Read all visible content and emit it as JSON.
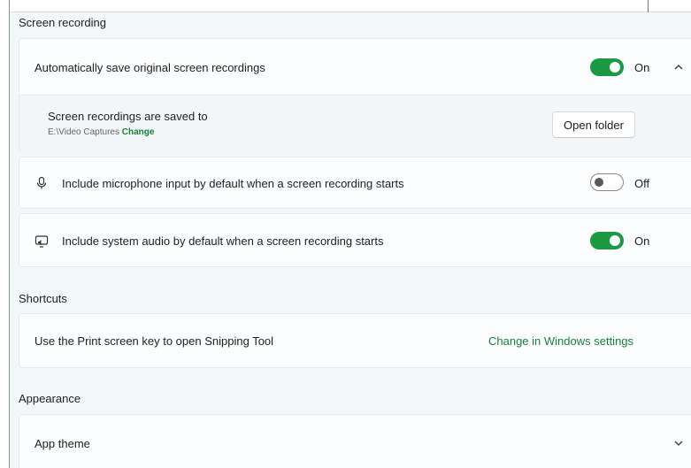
{
  "screen_recording": {
    "section_title": "Screen recording",
    "auto_save": {
      "label": "Automatically save original screen recordings",
      "state": "On",
      "enabled": true
    },
    "save_location": {
      "label": "Screen recordings are saved to",
      "path": "E:\\Video Captures",
      "change_link": "Change",
      "open_folder_button": "Open folder"
    },
    "microphone": {
      "label": "Include microphone input by default when a screen recording starts",
      "state": "Off",
      "enabled": false,
      "icon": "microphone-icon"
    },
    "system_audio": {
      "label": "Include system audio by default when a screen recording starts",
      "state": "On",
      "enabled": true,
      "icon": "system-audio-icon"
    }
  },
  "shortcuts": {
    "section_title": "Shortcuts",
    "print_screen": {
      "label": "Use the Print screen key to open Snipping Tool",
      "link": "Change in Windows settings"
    }
  },
  "appearance": {
    "section_title": "Appearance",
    "app_theme": {
      "label": "App theme"
    }
  },
  "colors": {
    "accent": "#1a9a43",
    "link": "#17803d",
    "page_background": "#f2f7fa",
    "card_background": "#fbfdfe"
  }
}
